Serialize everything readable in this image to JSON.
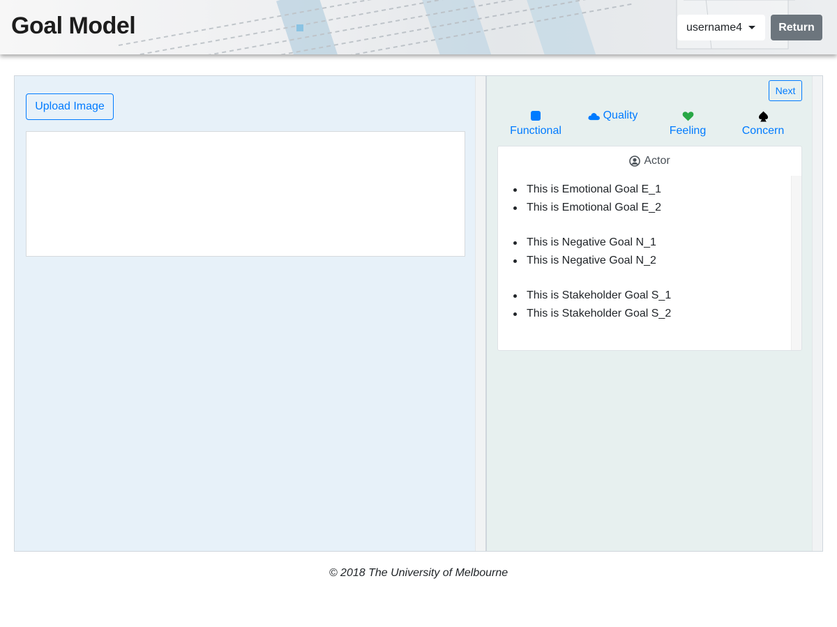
{
  "header": {
    "title": "Goal Model",
    "user_label": "username4",
    "return_label": "Return"
  },
  "left_panel": {
    "upload_label": "Upload Image"
  },
  "right_panel": {
    "next_label": "Next",
    "palette": [
      {
        "label": "Functional",
        "icon": "square-icon",
        "color": "#007bff"
      },
      {
        "label": "Quality",
        "icon": "cloud-icon",
        "color": "#007bff"
      },
      {
        "label": "Feeling",
        "icon": "heart-icon",
        "color": "#28a745"
      },
      {
        "label": "Concern",
        "icon": "spade-icon",
        "color": "#000000"
      }
    ],
    "actor": {
      "label": "Actor",
      "emotional_goals": [
        "This is Emotional Goal E_1",
        "This is Emotional Goal E_2"
      ],
      "negative_goals": [
        "This is Negative Goal N_1",
        "This is Negative Goal N_2"
      ],
      "stakeholder_goals": [
        "This is Stakeholder Goal S_1",
        "This is Stakeholder Goal S_2"
      ]
    }
  },
  "footer": {
    "text": "© 2018 The University of Melbourne"
  }
}
